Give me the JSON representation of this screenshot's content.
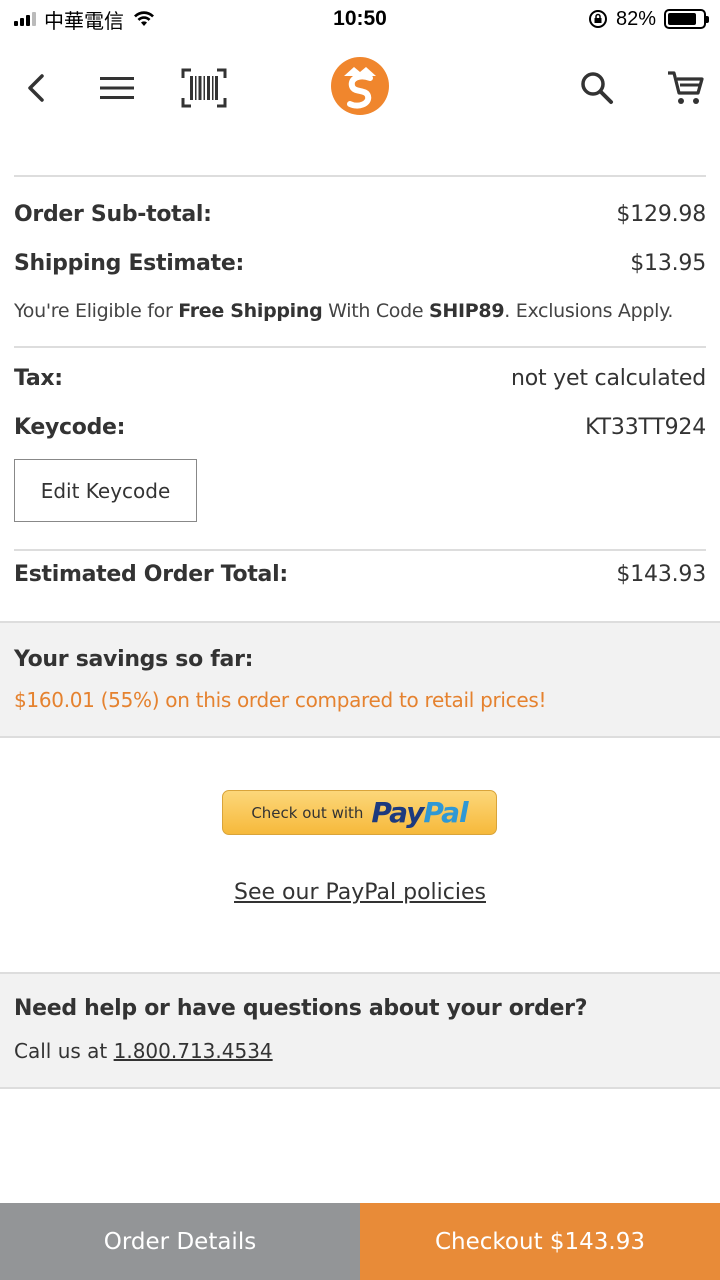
{
  "status_bar": {
    "carrier": "中華電信",
    "time": "10:50",
    "battery_percent": "82%",
    "battery_level": 0.82
  },
  "nav": {
    "icons": [
      "back-arrow-icon",
      "menu-icon",
      "barcode-scanner-icon",
      "brand-logo",
      "search-icon",
      "cart-icon"
    ],
    "brand_color": "#f0862d"
  },
  "summary": {
    "subtotal_label": "Order Sub-total:",
    "subtotal_value": "$129.98",
    "shipping_label": "Shipping Estimate:",
    "shipping_value": "$13.95",
    "free_ship_pre": "You're Eligible for ",
    "free_ship_bold": "Free Shipping",
    "free_ship_mid": " With Code ",
    "free_ship_code": "SHIP89",
    "free_ship_post": ". Exclusions Apply.",
    "tax_label": "Tax:",
    "tax_value": "not yet calculated",
    "keycode_label": "Keycode:",
    "keycode_value": "KT33TT924",
    "edit_keycode_label": "Edit Keycode",
    "total_label": "Estimated Order Total:",
    "total_value": "$143.93"
  },
  "savings": {
    "title": "Your savings so far:",
    "text": "$160.01 (55%) on this order compared to retail prices!",
    "color": "#e5822f"
  },
  "paypal": {
    "pre_label": "Check out with",
    "logo_part1": "Pay",
    "logo_part2": "Pal",
    "policies_link": "See our PayPal policies"
  },
  "help": {
    "title": "Need help or have questions about your order?",
    "call_prefix": "Call us at ",
    "phone": "1.800.713.4534"
  },
  "bottom_bar": {
    "details_label": "Order Details",
    "checkout_label": "Checkout $143.93",
    "details_color": "#939597",
    "checkout_color": "#e88b38"
  }
}
